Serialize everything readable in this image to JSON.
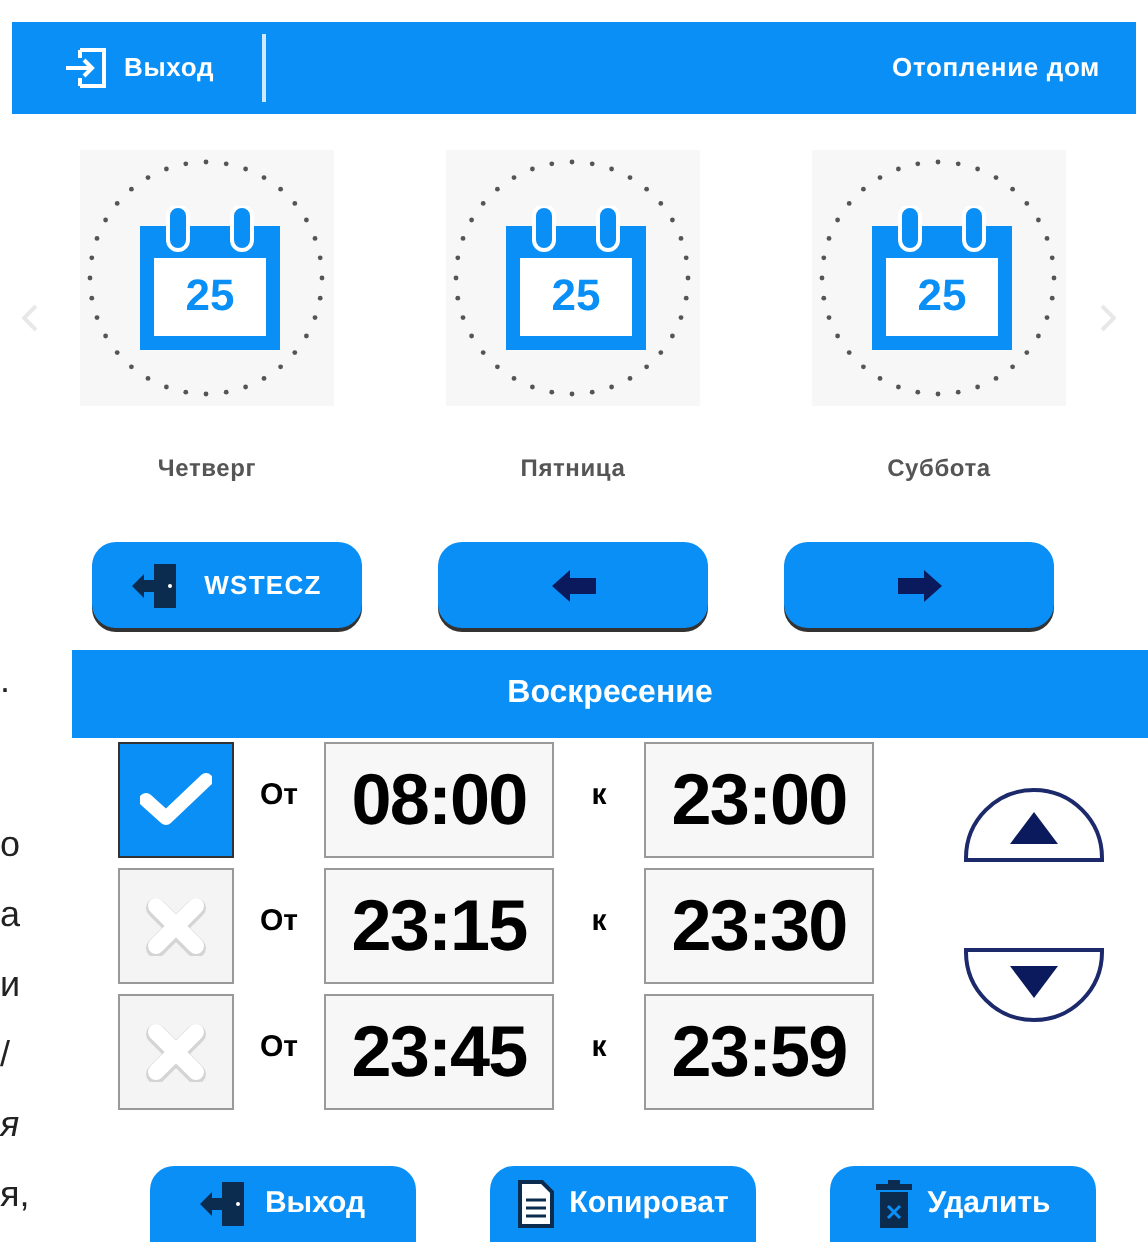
{
  "header": {
    "exit_label": "Выход",
    "title": "Отопление дом"
  },
  "days": [
    {
      "label": "Четверг",
      "date": "25"
    },
    {
      "label": "Пятница",
      "date": "25"
    },
    {
      "label": "Суббота",
      "date": "25"
    }
  ],
  "nav_buttons": [
    {
      "kind": "back",
      "label": "WSTECZ"
    },
    {
      "kind": "prev"
    },
    {
      "kind": "next"
    }
  ],
  "day_title": "Воскресение",
  "intervals": [
    {
      "checked": true,
      "from_label": "От",
      "from": "08:00",
      "to_label": "к",
      "to": "23:00"
    },
    {
      "checked": false,
      "from_label": "От",
      "from": "23:15",
      "to_label": "к",
      "to": "23:30"
    },
    {
      "checked": false,
      "from_label": "От",
      "from": "23:45",
      "to_label": "к",
      "to": "23:59"
    }
  ],
  "footer_buttons": [
    {
      "kind": "exit",
      "label": "Выход"
    },
    {
      "kind": "copy",
      "label": "Копироват"
    },
    {
      "kind": "delete",
      "label": "Удалить"
    }
  ],
  "margin_text": [
    {
      "text": ".",
      "italic": false
    },
    {
      "text": "о",
      "italic": false
    },
    {
      "text": "а",
      "italic": false
    },
    {
      "text": "и",
      "italic": false
    },
    {
      "text": "/",
      "italic": false
    },
    {
      "text": "я",
      "italic": true
    },
    {
      "text": "я,",
      "italic": false
    }
  ]
}
